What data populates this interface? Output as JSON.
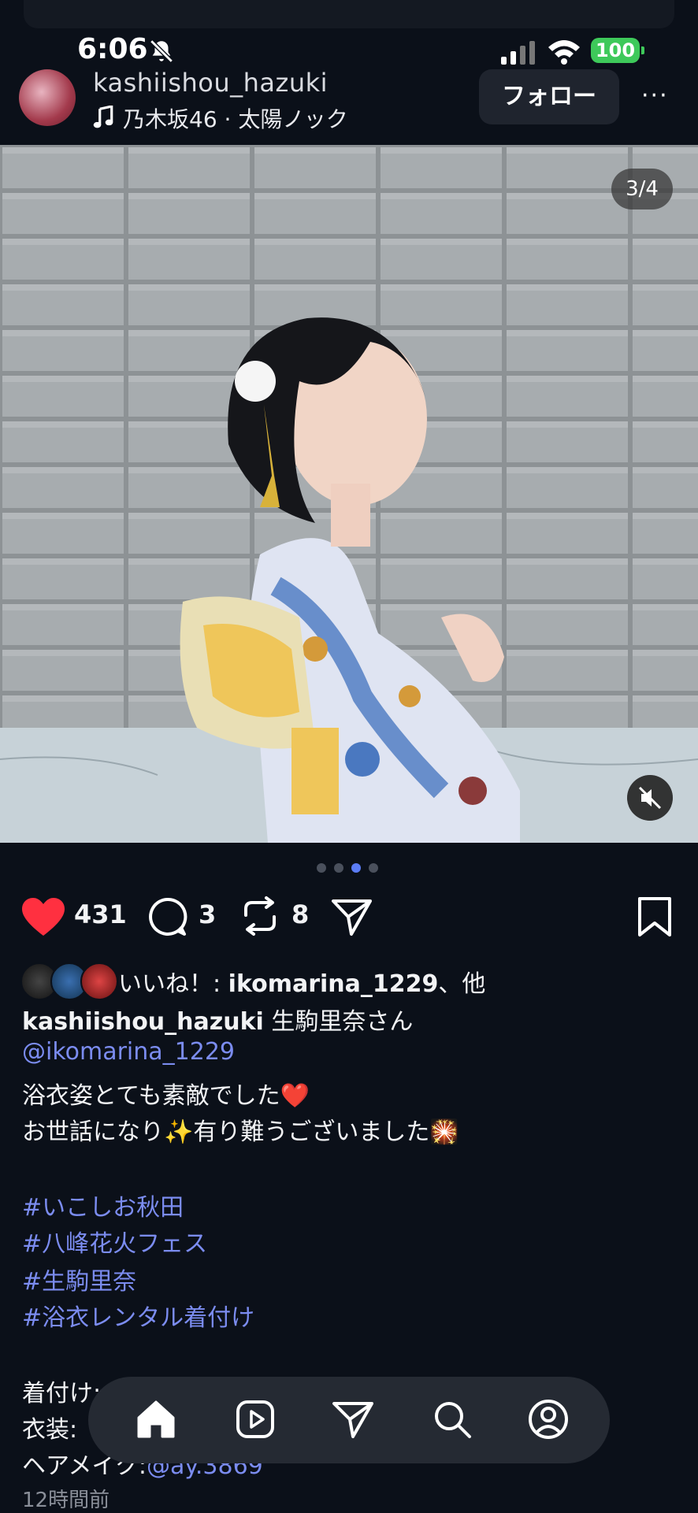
{
  "status_bar": {
    "time": "6:06",
    "battery": "100"
  },
  "header": {
    "username": "kashiishou_hazuki",
    "song": "乃木坂46 · 太陽ノック",
    "follow_label": "フォロー",
    "more_label": "···"
  },
  "photo": {
    "counter": "3/4",
    "carousel_index": 3,
    "carousel_total": 4
  },
  "actions": {
    "likes": "431",
    "comments": "3",
    "reposts": "8"
  },
  "liked_by": {
    "prefix": "いいね！: ",
    "user": "ikomarina_1229",
    "suffix": "、他"
  },
  "caption": {
    "username": "kashiishou_hazuki",
    "text_1": " 生駒里奈さん",
    "mention": "@ikomarina_1229",
    "line_3": "浴衣姿とても素敵でした❤️",
    "line_4": "お世話になり✨有り難うございました🎇",
    "hashtags": [
      "#いこしお秋田",
      "#八峰花火フェス",
      "#生駒里奈",
      "#浴衣レンタル着付け"
    ],
    "line_kitsuke": "着付け:",
    "line_ishou": "衣装:",
    "line_hair": "ヘアメイク:",
    "hair_mention": "@ay.3869",
    "timestamp": "12時間前"
  },
  "colors": {
    "background": "#0b1019",
    "link": "#7b8cf0",
    "like_red": "#ff3040",
    "battery_green": "#3ec95a"
  },
  "icons": [
    "bell-slash-icon",
    "signal-icon",
    "wifi-icon",
    "music-note-icon",
    "more-icon",
    "mute-icon",
    "heart-icon",
    "comment-icon",
    "repost-icon",
    "share-icon",
    "bookmark-icon",
    "home-icon",
    "reels-icon",
    "messages-icon",
    "search-icon",
    "profile-icon"
  ]
}
